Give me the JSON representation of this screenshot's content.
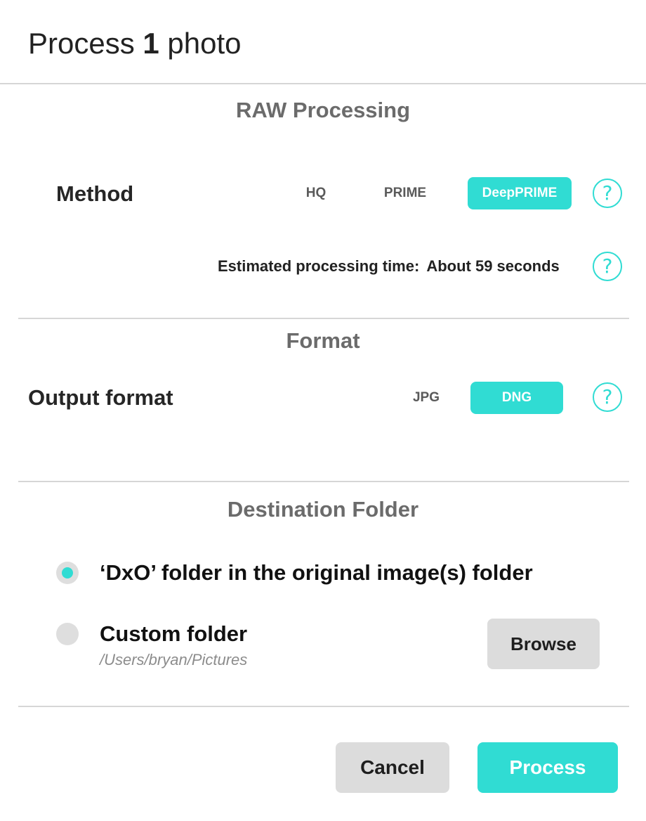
{
  "dialog": {
    "title_prefix": "Process ",
    "title_count": "1",
    "title_suffix": " photo"
  },
  "raw_processing": {
    "heading": "RAW Processing",
    "method_label": "Method",
    "methods": [
      {
        "label": "HQ",
        "selected": false
      },
      {
        "label": "PRIME",
        "selected": false
      },
      {
        "label": "DeepPRIME",
        "selected": true
      }
    ],
    "help_glyph": "?",
    "estimate_label": "Estimated processing time:",
    "estimate_value": "About 59 seconds"
  },
  "format": {
    "heading": "Format",
    "output_label": "Output format",
    "options": [
      {
        "label": "JPG",
        "selected": false
      },
      {
        "label": "DNG",
        "selected": true
      }
    ]
  },
  "destination": {
    "heading": "Destination Folder",
    "options": [
      {
        "label": "‘DxO’ folder in the original image(s) folder",
        "selected": true
      },
      {
        "label": "Custom folder",
        "selected": false
      }
    ],
    "custom_path": "/Users/bryan/Pictures",
    "browse_label": "Browse"
  },
  "footer": {
    "cancel_label": "Cancel",
    "process_label": "Process"
  },
  "colors": {
    "accent": "#30dcd3",
    "button_gray": "#dcdcdc",
    "divider": "#d6d6d6",
    "heading_gray": "#6b6b6b"
  },
  "icons": [
    "help-icon",
    "radio-selected-icon",
    "radio-unselected-icon"
  ]
}
